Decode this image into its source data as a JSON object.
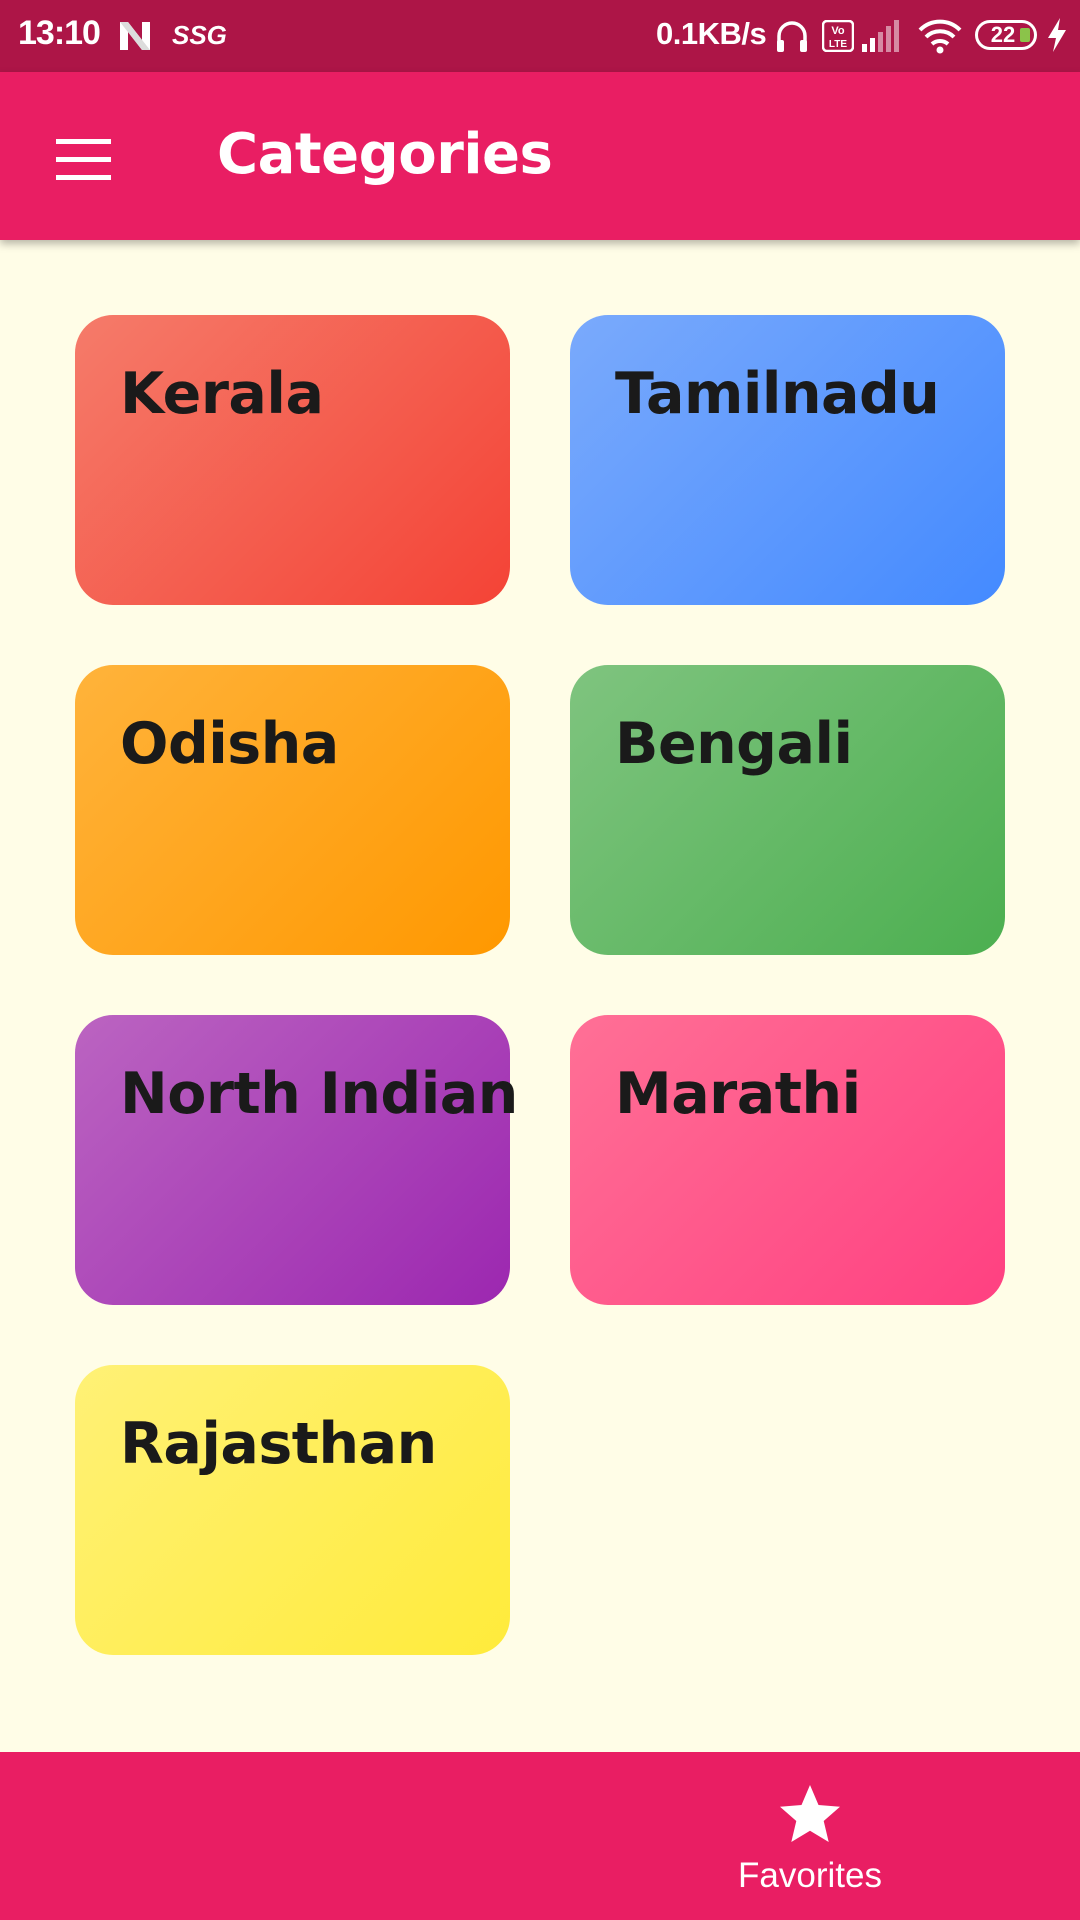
{
  "status_bar": {
    "time": "13:10",
    "carrier_label": "SSG",
    "network_speed": "0.1KB/s",
    "battery_level": "22",
    "icons": [
      "n-icon",
      "headphone-icon",
      "volte-icon",
      "signal-icon",
      "wifi-icon",
      "battery-icon",
      "charging-icon"
    ]
  },
  "app_bar": {
    "menu_icon": "hamburger-menu-icon",
    "title": "Categories"
  },
  "categories": [
    {
      "label": "Kerala",
      "gradient": [
        "#f57b6a",
        "#f44336"
      ]
    },
    {
      "label": "Tamilnadu",
      "gradient": [
        "#7aaafc",
        "#448aff"
      ]
    },
    {
      "label": "Odisha",
      "gradient": [
        "#ffb33b",
        "#ff9800"
      ]
    },
    {
      "label": "Bengali",
      "gradient": [
        "#7fc47f",
        "#4caf50"
      ]
    },
    {
      "label": "North Indian",
      "gradient": [
        "#bb64c1",
        "#9c27b0"
      ]
    },
    {
      "label": "Marathi",
      "gradient": [
        "#ff7096",
        "#ff4081"
      ]
    },
    {
      "label": "Rajasthan",
      "gradient": [
        "#fff176",
        "#ffeb3b"
      ]
    }
  ],
  "bottom_nav": {
    "items": [
      {
        "icon": "star-icon",
        "label": "Favorites"
      }
    ]
  },
  "colors": {
    "primary": "#e91e63",
    "status_bar": "#ad1547",
    "background": "#fffde7"
  }
}
